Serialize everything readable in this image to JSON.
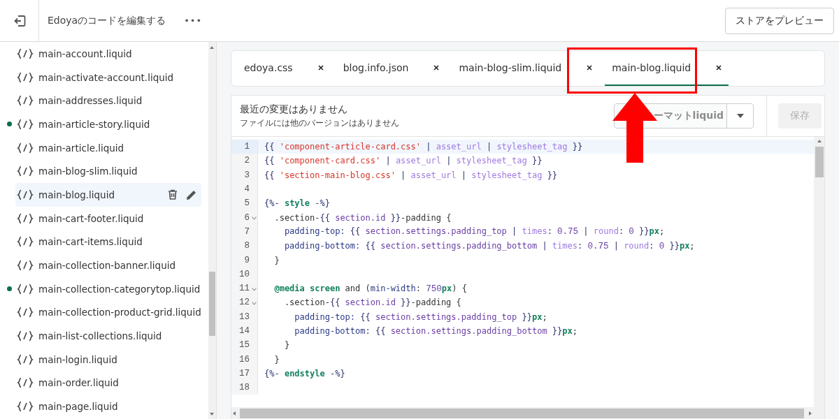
{
  "topbar": {
    "title": "Edoyaのコードを編集する",
    "menu": "•••",
    "preview_button": "ストアをプレビュー"
  },
  "sidebar": {
    "items": [
      {
        "name": "main-account.liquid",
        "modified": false,
        "selected": false
      },
      {
        "name": "main-activate-account.liquid",
        "modified": false,
        "selected": false
      },
      {
        "name": "main-addresses.liquid",
        "modified": false,
        "selected": false
      },
      {
        "name": "main-article-story.liquid",
        "modified": true,
        "selected": false
      },
      {
        "name": "main-article.liquid",
        "modified": false,
        "selected": false
      },
      {
        "name": "main-blog-slim.liquid",
        "modified": false,
        "selected": false
      },
      {
        "name": "main-blog.liquid",
        "modified": false,
        "selected": true
      },
      {
        "name": "main-cart-footer.liquid",
        "modified": false,
        "selected": false
      },
      {
        "name": "main-cart-items.liquid",
        "modified": false,
        "selected": false
      },
      {
        "name": "main-collection-banner.liquid",
        "modified": false,
        "selected": false
      },
      {
        "name": "main-collection-categorytop.liquid",
        "modified": true,
        "selected": false
      },
      {
        "name": "main-collection-product-grid.liquid",
        "modified": false,
        "selected": false
      },
      {
        "name": "main-list-collections.liquid",
        "modified": false,
        "selected": false
      },
      {
        "name": "main-login.liquid",
        "modified": false,
        "selected": false
      },
      {
        "name": "main-order.liquid",
        "modified": false,
        "selected": false
      },
      {
        "name": "main-page.liquid",
        "modified": false,
        "selected": false
      }
    ]
  },
  "tabs": [
    {
      "label": "edoya.css",
      "selected": false
    },
    {
      "label": "blog.info.json",
      "selected": false
    },
    {
      "label": "main-blog-slim.liquid",
      "selected": false
    },
    {
      "label": "main-blog.liquid",
      "selected": true
    }
  ],
  "editor": {
    "status": "最近の変更はありません",
    "versions": "ファイルには他のバージョンはありません",
    "format_button": "ーマットliquid",
    "save_button": "保存",
    "save_disabled": true,
    "lines": [
      {
        "number": "1",
        "active": true,
        "fold": false,
        "tokens": [
          {
            "kind": "punct",
            "text": "{{ "
          },
          {
            "kind": "str",
            "text": "'component-article-card.css'"
          },
          {
            "kind": "punct",
            "text": " | "
          },
          {
            "kind": "filter",
            "text": "asset_url"
          },
          {
            "kind": "punct",
            "text": " | "
          },
          {
            "kind": "filter",
            "text": "stylesheet_tag"
          },
          {
            "kind": "punct",
            "text": " }}"
          }
        ]
      },
      {
        "number": "2",
        "active": false,
        "fold": false,
        "tokens": [
          {
            "kind": "punct",
            "text": "{{ "
          },
          {
            "kind": "str",
            "text": "'component-card.css'"
          },
          {
            "kind": "punct",
            "text": " | "
          },
          {
            "kind": "filter",
            "text": "asset_url"
          },
          {
            "kind": "punct",
            "text": " | "
          },
          {
            "kind": "filter",
            "text": "stylesheet_tag"
          },
          {
            "kind": "punct",
            "text": " }}"
          }
        ]
      },
      {
        "number": "3",
        "active": false,
        "fold": false,
        "tokens": [
          {
            "kind": "punct",
            "text": "{{ "
          },
          {
            "kind": "str",
            "text": "'section-main-blog.css'"
          },
          {
            "kind": "punct",
            "text": " | "
          },
          {
            "kind": "filter",
            "text": "asset_url"
          },
          {
            "kind": "punct",
            "text": " | "
          },
          {
            "kind": "filter",
            "text": "stylesheet_tag"
          },
          {
            "kind": "punct",
            "text": " }}"
          }
        ]
      },
      {
        "number": "4",
        "active": false,
        "fold": false
      },
      {
        "number": "5",
        "active": false,
        "fold": false,
        "tokens": [
          {
            "kind": "punct",
            "text": "{%- "
          },
          {
            "kind": "kw",
            "text": "style"
          },
          {
            "kind": "punct",
            "text": " -%}"
          }
        ]
      },
      {
        "number": "6",
        "active": false,
        "fold": true,
        "tokens": [
          {
            "kind": "text",
            "text": "  .section-"
          },
          {
            "kind": "punct",
            "text": "{{ "
          },
          {
            "kind": "var",
            "text": "section.id"
          },
          {
            "kind": "punct",
            "text": " }}"
          },
          {
            "kind": "text",
            "text": "-padding {"
          }
        ]
      },
      {
        "number": "7",
        "active": false,
        "fold": false,
        "tokens": [
          {
            "kind": "prop",
            "text": "    padding-top: "
          },
          {
            "kind": "punct",
            "text": "{{ "
          },
          {
            "kind": "var",
            "text": "section.settings.padding_top"
          },
          {
            "kind": "punct",
            "text": " | "
          },
          {
            "kind": "filter",
            "text": "times"
          },
          {
            "kind": "punct",
            "text": ": "
          },
          {
            "kind": "num",
            "text": "0.75"
          },
          {
            "kind": "punct",
            "text": " | "
          },
          {
            "kind": "filter",
            "text": "round"
          },
          {
            "kind": "punct",
            "text": ": "
          },
          {
            "kind": "num",
            "text": "0"
          },
          {
            "kind": "punct",
            "text": " }}"
          },
          {
            "kind": "kw",
            "text": "px"
          },
          {
            "kind": "text",
            "text": ";"
          }
        ]
      },
      {
        "number": "8",
        "active": false,
        "fold": false,
        "tokens": [
          {
            "kind": "prop",
            "text": "    padding-bottom: "
          },
          {
            "kind": "punct",
            "text": "{{ "
          },
          {
            "kind": "var",
            "text": "section.settings.padding_bottom"
          },
          {
            "kind": "punct",
            "text": " | "
          },
          {
            "kind": "filter",
            "text": "times"
          },
          {
            "kind": "punct",
            "text": ": "
          },
          {
            "kind": "num",
            "text": "0.75"
          },
          {
            "kind": "punct",
            "text": " | "
          },
          {
            "kind": "filter",
            "text": "round"
          },
          {
            "kind": "punct",
            "text": ": "
          },
          {
            "kind": "num",
            "text": "0"
          },
          {
            "kind": "punct",
            "text": " }}"
          },
          {
            "kind": "kw",
            "text": "px"
          },
          {
            "kind": "text",
            "text": ";"
          }
        ]
      },
      {
        "number": "9",
        "active": false,
        "fold": false,
        "tokens": [
          {
            "kind": "text",
            "text": "  }"
          }
        ]
      },
      {
        "number": "10",
        "active": false,
        "fold": false
      },
      {
        "number": "11",
        "active": false,
        "fold": true,
        "tokens": [
          {
            "kind": "kw",
            "text": "  @media screen"
          },
          {
            "kind": "text",
            "text": " and ("
          },
          {
            "kind": "prop",
            "text": "min-width"
          },
          {
            "kind": "text",
            "text": ": "
          },
          {
            "kind": "num",
            "text": "750"
          },
          {
            "kind": "kw",
            "text": "px"
          },
          {
            "kind": "text",
            "text": ") {"
          }
        ]
      },
      {
        "number": "12",
        "active": false,
        "fold": true,
        "tokens": [
          {
            "kind": "text",
            "text": "    .section-"
          },
          {
            "kind": "punct",
            "text": "{{ "
          },
          {
            "kind": "var",
            "text": "section.id"
          },
          {
            "kind": "punct",
            "text": " }}"
          },
          {
            "kind": "text",
            "text": "-padding {"
          }
        ]
      },
      {
        "number": "13",
        "active": false,
        "fold": false,
        "tokens": [
          {
            "kind": "prop",
            "text": "      padding-top: "
          },
          {
            "kind": "punct",
            "text": "{{ "
          },
          {
            "kind": "var",
            "text": "section.settings.padding_top"
          },
          {
            "kind": "punct",
            "text": " }}"
          },
          {
            "kind": "kw",
            "text": "px"
          },
          {
            "kind": "text",
            "text": ";"
          }
        ]
      },
      {
        "number": "14",
        "active": false,
        "fold": false,
        "tokens": [
          {
            "kind": "prop",
            "text": "      padding-bottom: "
          },
          {
            "kind": "punct",
            "text": "{{ "
          },
          {
            "kind": "var",
            "text": "section.settings.padding_bottom"
          },
          {
            "kind": "punct",
            "text": " }}"
          },
          {
            "kind": "kw",
            "text": "px"
          },
          {
            "kind": "text",
            "text": ";"
          }
        ]
      },
      {
        "number": "15",
        "active": false,
        "fold": false,
        "tokens": [
          {
            "kind": "text",
            "text": "    }"
          }
        ]
      },
      {
        "number": "16",
        "active": false,
        "fold": false,
        "tokens": [
          {
            "kind": "text",
            "text": "  }"
          }
        ]
      },
      {
        "number": "17",
        "active": false,
        "fold": false,
        "tokens": [
          {
            "kind": "punct",
            "text": "{%- "
          },
          {
            "kind": "kw",
            "text": "endstyle"
          },
          {
            "kind": "punct",
            "text": " -%}"
          }
        ]
      },
      {
        "number": "18",
        "active": false,
        "fold": false
      }
    ]
  }
}
